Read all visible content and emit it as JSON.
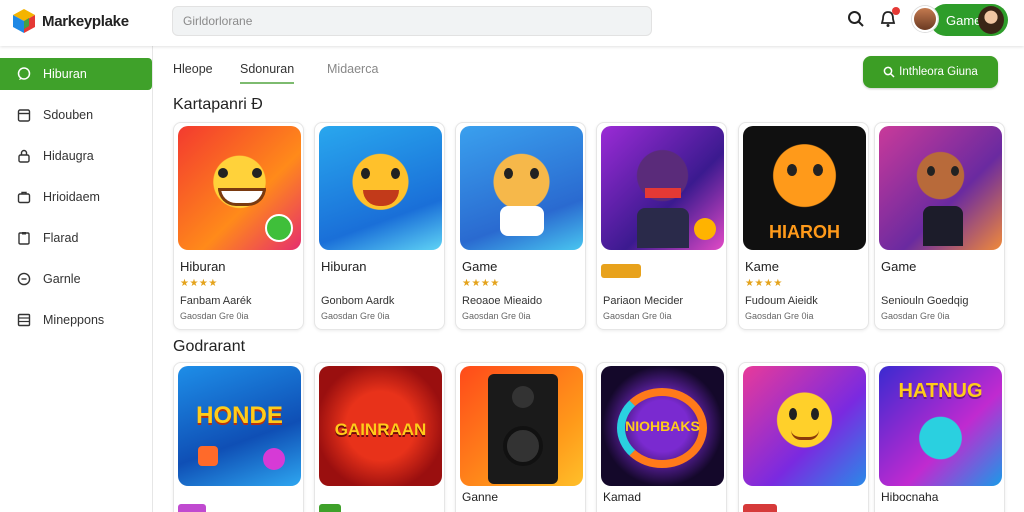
{
  "header": {
    "logo_text": "Markeyplake",
    "search_placeholder": "Girldorlorane",
    "pill_label": "Game"
  },
  "sidebar": {
    "items": [
      {
        "label": "Hiburan",
        "icon": "chat-icon",
        "active": true
      },
      {
        "label": "Sdouben",
        "icon": "calendar-icon"
      },
      {
        "label": "Hidaugra",
        "icon": "lock-icon"
      },
      {
        "label": "Hrioidaem",
        "icon": "briefcase-icon"
      },
      {
        "label": "Flarad",
        "icon": "clipboard-icon"
      },
      {
        "label": "Garnle",
        "icon": "clock-icon"
      },
      {
        "label": "Mineppons",
        "icon": "table-icon"
      }
    ]
  },
  "tabs": [
    {
      "label": "Hleope"
    },
    {
      "label": "Sdonuran"
    },
    {
      "label": "Midaerca"
    }
  ],
  "cta_label": "Inthleora Giuna",
  "sections": [
    {
      "title": "Kartapanri Đ"
    },
    {
      "title": "Godrarant"
    }
  ],
  "row1": [
    {
      "title": "Hiburan",
      "stars": "★★★★",
      "subtitle": "Fanbam Aarék",
      "meta": "Gaosdan Gre 0ia",
      "art_text": ""
    },
    {
      "title": "Hiburan",
      "stars": "",
      "subtitle": "Gonbom Aardk",
      "meta": "Gaosdan Gre 0ia",
      "art_text": ""
    },
    {
      "title": "Game",
      "stars": "★★★★",
      "subtitle": "Reoaoe Mieaido",
      "meta": "Gaosdan Gre 0ia",
      "art_text": ""
    },
    {
      "title": "",
      "stars": "",
      "subtitle": "Pariaon Mecider",
      "meta": "Gaosdan Gre 0ia",
      "art_text": ""
    },
    {
      "title": "Kame",
      "stars": "★★★★",
      "subtitle": "Fudoum Aieidk",
      "meta": "Gaosdan Gre 0ia",
      "art_text": "HIAROH"
    },
    {
      "title": "Game",
      "stars": "",
      "subtitle": "Seniouln Goedqig",
      "meta": "Gaosdan Gre 0ia",
      "art_text": ""
    }
  ],
  "row2": [
    {
      "title": "",
      "art_text": "HONDE"
    },
    {
      "title": "",
      "art_text": "GAINRAAN"
    },
    {
      "title": "Ganne",
      "art_text": ""
    },
    {
      "title": "Kamad",
      "art_text": "NIOHBAKS"
    },
    {
      "title": "",
      "art_text": ""
    },
    {
      "title": "Hibocnaha",
      "art_text": "HATNUG"
    }
  ],
  "colors": {
    "accent_green": "#3fa12a",
    "star_gold": "#e4a31c"
  }
}
